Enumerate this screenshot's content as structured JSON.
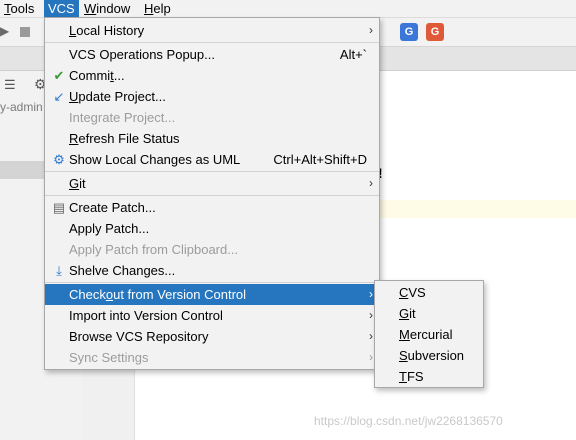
{
  "menubar": {
    "items": [
      {
        "label": "Tools",
        "u": "T",
        "rest": "ools"
      },
      {
        "label": "VCS",
        "u": "",
        "rest": "VCS"
      },
      {
        "label": "Window",
        "u": "W",
        "rest": "indow"
      },
      {
        "label": "Help",
        "u": "H",
        "rest": "elp"
      }
    ]
  },
  "background": {
    "project_fragment": "y-admin",
    "editor_fragment": "!",
    "watermark": "https://blog.csdn.net/jw2268136570"
  },
  "vcs_menu": {
    "local_history": {
      "u": "L",
      "rest": "ocal History"
    },
    "operations_popup": {
      "label": "VCS Operations Popup...",
      "shortcut": "Alt+`"
    },
    "commit": {
      "pre": "Commi",
      "u": "t",
      "post": "..."
    },
    "update_project": {
      "u": "U",
      "rest": "pdate Project..."
    },
    "integrate_project": {
      "label": "Integrate Project..."
    },
    "refresh_status": {
      "u": "R",
      "rest": "efresh File Status"
    },
    "show_local_changes": {
      "label": "Show Local Changes as UML",
      "shortcut": "Ctrl+Alt+Shift+D"
    },
    "git": {
      "u": "G",
      "rest": "it"
    },
    "create_patch": {
      "label": "Create Patch..."
    },
    "apply_patch": {
      "label": "Apply Patch..."
    },
    "apply_patch_clipboard": {
      "label": "Apply Patch from Clipboard..."
    },
    "shelve_changes": {
      "label": "Shelve Changes..."
    },
    "checkout": {
      "pre": "Check",
      "u": "o",
      "post": "ut from Version Control"
    },
    "import": {
      "label": "Import into Version Control"
    },
    "browse_repo": {
      "label": "Browse VCS Repository"
    },
    "sync_settings": {
      "label": "Sync Settings"
    }
  },
  "checkout_submenu": {
    "items": [
      {
        "u": "C",
        "rest": "VS"
      },
      {
        "u": "G",
        "rest": "it"
      },
      {
        "u": "M",
        "rest": "ercurial"
      },
      {
        "u": "S",
        "rest": "ubversion"
      },
      {
        "u": "T",
        "rest": "FS"
      }
    ]
  }
}
